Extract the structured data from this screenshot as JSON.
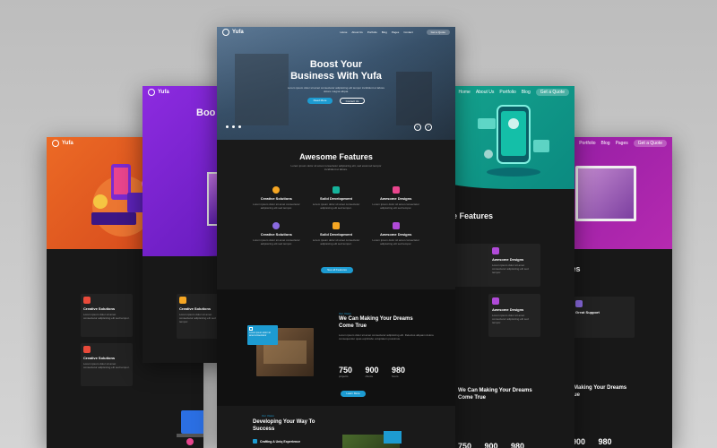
{
  "brand": "Yufa",
  "nav": {
    "items": [
      "Home",
      "About Us",
      "Portfolio",
      "Blog",
      "Pages",
      "Contact"
    ],
    "cta": "Get a Quote"
  },
  "hero": {
    "title_line1": "Boost Your",
    "title_line2": "Business With Yufa",
    "subtitle": "Lorem ipsum dolor sit amet consectetur adipisicing elit tempor incididunt ut labore dolore magna aliqua.",
    "btn_primary": "Read More",
    "btn_secondary": "Contact Us",
    "purple_title_fragment": "Boo"
  },
  "features": {
    "title": "Awesome Features",
    "subtitle": "Lorem ipsum dolor sit amet consectetur adipisicing elit, sed eiusmod tempor incididunt ut labore.",
    "items": [
      {
        "title": "Creative Solutions",
        "text": "Lorem ipsum dolor sit amet consectetur adipisicing elit sed tempor."
      },
      {
        "title": "Solid Development",
        "text": "Lorem ipsum dolor sit amet consectetur adipisicing elit sed tempor."
      },
      {
        "title": "Awesome Designs",
        "text": "Lorem ipsum dolor sit amet consectetur adipisicing elit sed tempor."
      },
      {
        "title": "Creative Solutions",
        "text": "Lorem ipsum dolor sit amet consectetur adipisicing elit sed tempor."
      },
      {
        "title": "Solid Development",
        "text": "Lorem ipsum dolor sit amet consectetur adipisicing elit sed tempor."
      },
      {
        "title": "Awesome Designs",
        "text": "Lorem ipsum dolor sit amet consectetur adipisicing elit sed tempor."
      }
    ],
    "button": "See all Features",
    "fragment_right": "e Features",
    "fragment_left": "Awe",
    "fragment_far_right": "res"
  },
  "dreams": {
    "eyebrow": "Our Vision",
    "title_line1": "We Can Making Your Dreams",
    "title_line2": "Come True",
    "text": "Lorem ipsum dolor sit amet consectetur adipisicing elit. Delectus aliquam dolore consequuntur quas explicabo voluptatem possimus.",
    "stats": [
      {
        "num": "750",
        "label": "projects"
      },
      {
        "num": "900",
        "label": "clients"
      },
      {
        "num": "980",
        "label": "hours"
      }
    ],
    "button": "Learn More",
    "badge_text": "Lorem ipsum dolor sit amet consectetur"
  },
  "develop": {
    "eyebrow": "Our Vision",
    "title_line1": "Developing Your Way To",
    "title_line2": "Success",
    "item1": "Crafting A Uniq Experience"
  },
  "extra": {
    "right_support": "Great Support",
    "right_fragment1": "Making Your Dreams",
    "right_fragment2": "ue"
  },
  "colors": {
    "orange": "#e2571f",
    "purple": "#7a1fcf",
    "teal": "#15a58f",
    "magenta": "#9c1fa8",
    "accent_blue": "#1d9bd1"
  }
}
